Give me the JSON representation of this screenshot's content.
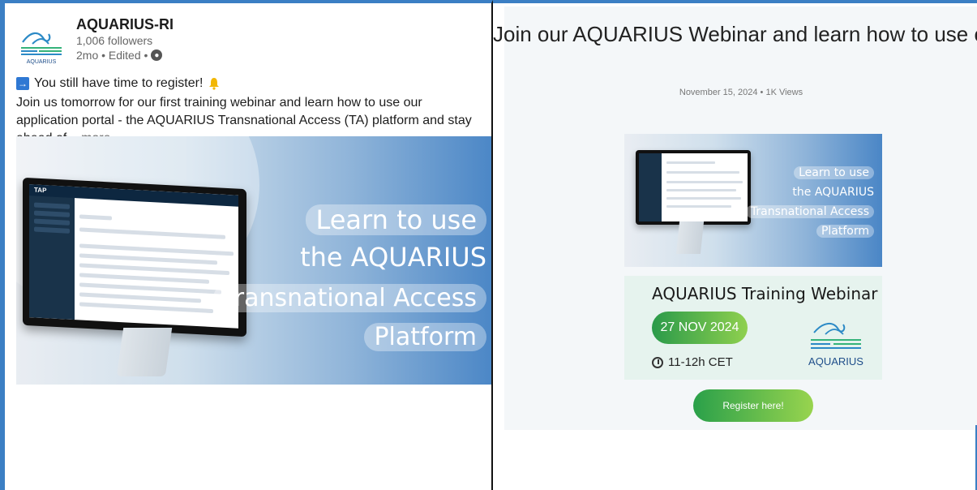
{
  "left_post": {
    "org_name": "AQUARIUS-RI",
    "followers": "1,006 followers",
    "meta": "2mo • Edited •",
    "logo_text": "AQUARIUS",
    "line1": "You still have time to register!",
    "body": "Join us tomorrow for our first training webinar and learn how to use our application portal - the AQUARIUS Transnational Access (TA) platform and stay ahead of",
    "more": "...more",
    "image_text": {
      "line1": "Learn to use",
      "line2": "the AQUARIUS",
      "line3": "Transnational Access",
      "line4": "Platform"
    },
    "monitor_label": "TAP"
  },
  "right_panel": {
    "title": "Join our AQUARIUS Webinar and learn how to use our Transnational Access Platform",
    "date_views": "November 15, 2024  •  1K Views",
    "banner_text": {
      "line1": "Learn to use",
      "line2": "the AQUARIUS",
      "line3": "Transnational Access",
      "line4": "Platform"
    },
    "card": {
      "title": "AQUARIUS Training Webinar",
      "date": "27 NOV 2024",
      "time": "11-12h CET",
      "logo_label": "AQUARIUS"
    },
    "register_button": "Register here!"
  },
  "colors": {
    "accent_blue": "#3b7fc4",
    "green_start": "#2a9a4a",
    "green_end": "#8fd04e"
  }
}
